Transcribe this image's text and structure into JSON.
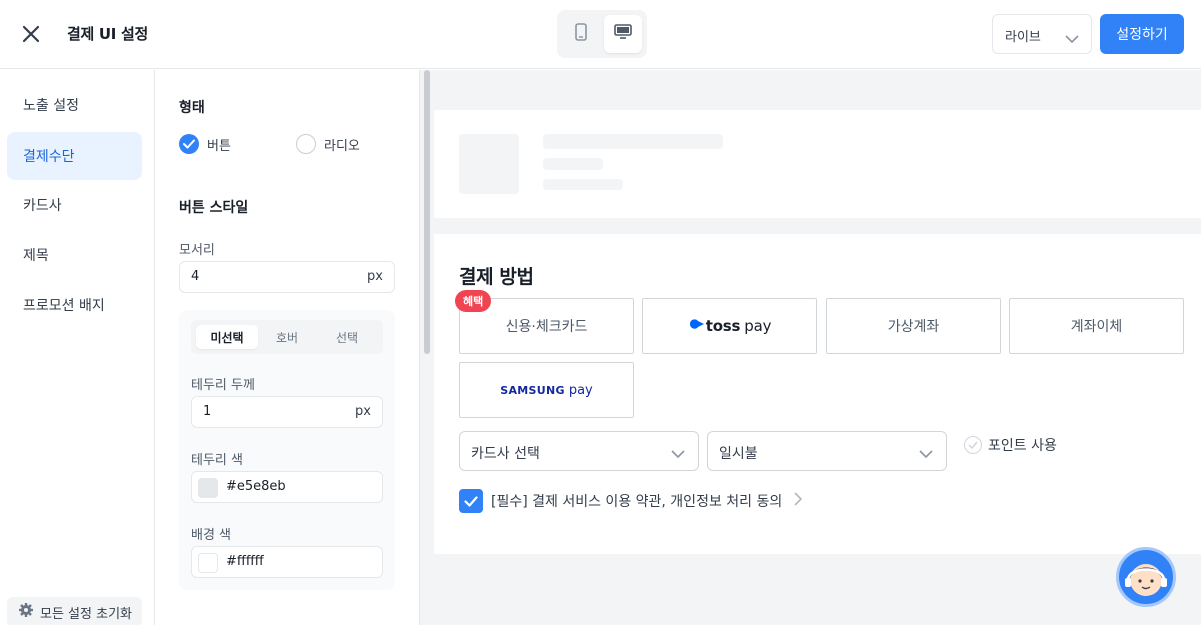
{
  "header": {
    "title": "결제 UI 설정",
    "env_select_value": "라이브",
    "apply_label": "설정하기"
  },
  "sidebar": {
    "items": [
      {
        "label": "노출 설정"
      },
      {
        "label": "결제수단"
      },
      {
        "label": "카드사"
      },
      {
        "label": "제목"
      },
      {
        "label": "프로모션 배지"
      }
    ],
    "active_index": 1,
    "reset_label": "모든 설정 초기화"
  },
  "panel": {
    "shape_title": "형태",
    "shape_options": [
      {
        "label": "버튼",
        "selected": true
      },
      {
        "label": "라디오",
        "selected": false
      }
    ],
    "button_style_title": "버튼 스타일",
    "corner_label": "모서리",
    "corner_value": "4",
    "corner_unit": "px",
    "state_tabs": [
      {
        "label": "미선택",
        "active": true
      },
      {
        "label": "호버",
        "active": false
      },
      {
        "label": "선택",
        "active": false
      }
    ],
    "border_width_label": "테두리 두께",
    "border_width_value": "1",
    "border_width_unit": "px",
    "border_color_label": "테두리 색",
    "border_color_value": "#e5e8eb",
    "bg_color_label": "배경 색",
    "bg_color_value": "#ffffff"
  },
  "preview": {
    "title": "결제 방법",
    "badge": "혜택",
    "methods": [
      {
        "label": "신용·체크카드",
        "logo": "text"
      },
      {
        "label": "toss pay",
        "logo": "toss"
      },
      {
        "label": "가상계좌",
        "logo": "text"
      },
      {
        "label": "계좌이체",
        "logo": "text"
      },
      {
        "label": "SAMSUNG pay",
        "logo": "samsung"
      }
    ],
    "toss_brand": "toss",
    "toss_pay": "pay",
    "samsung_brand": "SAMSUNG",
    "samsung_pay": "pay",
    "card_select_placeholder": "카드사 선택",
    "installment_value": "일시불",
    "point_label": "포인트 사용",
    "agree_label": "[필수] 결제 서비스 이용 약관, 개인정보 처리 동의"
  },
  "colors": {
    "accent": "#3182f6",
    "badge": "#f04452",
    "active_bg": "#e8f3ff"
  }
}
